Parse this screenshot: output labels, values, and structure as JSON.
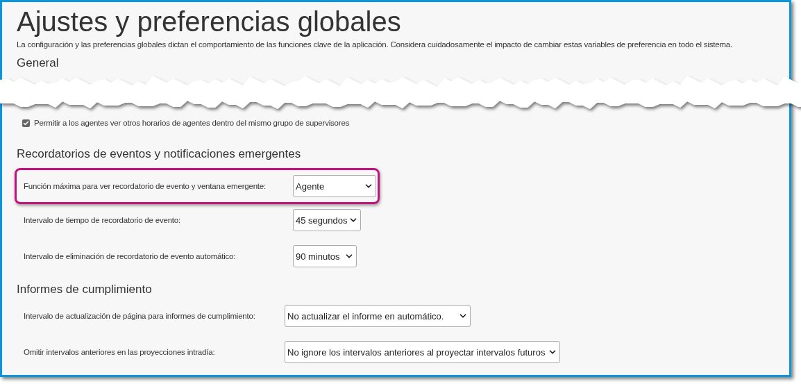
{
  "title": "Ajustes y preferencias globales",
  "description": "La configuración y las preferencias globales dictan el comportamiento de las funciones clave de la aplicación. Considera cuidadosamente el impacto de cambiar estas variables de preferencia en todo el sistema.",
  "sections": [
    {
      "heading": "General",
      "items": [
        {
          "kind": "checkbox",
          "label": "Permitir a los agentes ver otros horarios de agentes dentro del mismo grupo de supervisores",
          "checked": true
        }
      ]
    },
    {
      "heading": "Recordatorios de eventos y notificaciones emergentes",
      "items": [
        {
          "kind": "select",
          "label": "Función máxima para ver recordatorio de evento y ventana emergente:",
          "value": "Agente",
          "highlighted": true
        },
        {
          "kind": "select",
          "label": "Intervalo de tiempo de recordatorio de evento:",
          "value": "45 segundos",
          "highlighted": false
        },
        {
          "kind": "select",
          "label": "Intervalo de eliminación de recordatorio de evento automático:",
          "value": "90 minutos",
          "highlighted": false
        }
      ]
    },
    {
      "heading": "Informes de cumplimiento",
      "items": [
        {
          "kind": "select",
          "label": "Intervalo de actualización de página para informes de cumplimiento:",
          "value": "No actualizar el informe en automático.",
          "highlighted": false
        },
        {
          "kind": "select",
          "label": "Omitir intervalos anteriores en las proyecciones intradía:",
          "value": "No ignore los intervalos anteriores al proyectar intervalos futuros",
          "highlighted": false
        }
      ]
    }
  ]
}
